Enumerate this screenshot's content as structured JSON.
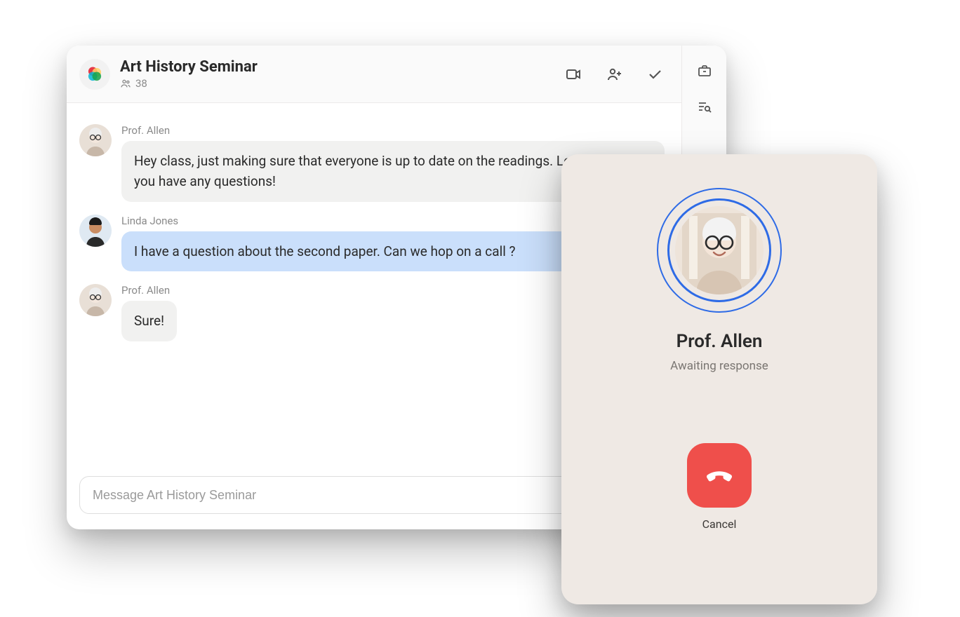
{
  "room": {
    "title": "Art History Seminar",
    "member_count": "38",
    "composer_placeholder": "Message Art History Seminar"
  },
  "messages": [
    {
      "sender": "Prof. Allen",
      "text": "Hey class, just making sure that everyone is up to date on the readings. Let me know if you have any questions!",
      "style": "gray",
      "wide": true
    },
    {
      "sender": "Linda Jones",
      "text": "I have a question about the second paper. Can we hop on a call ?",
      "style": "blue",
      "wide": true
    },
    {
      "sender": "Prof. Allen",
      "text": "Sure!",
      "style": "gray",
      "wide": false
    }
  ],
  "call": {
    "name": "Prof. Allen",
    "status": "Awaiting response",
    "cancel_label": "Cancel"
  }
}
